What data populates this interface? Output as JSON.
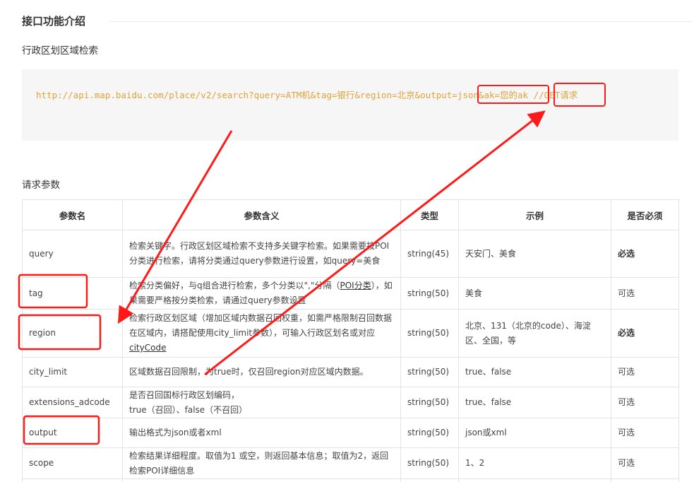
{
  "section": {
    "title": "接口功能介绍",
    "subtitle": "行政区划区域检索"
  },
  "code": {
    "url": "http://api.map.baidu.com/place/v2/search?query=ATM机&tag=银行&region=北京&output=json&ak=您的ak //GET请求"
  },
  "params": {
    "label": "请求参数",
    "headers": [
      "参数名",
      "参数含义",
      "类型",
      "示例",
      "是否必须"
    ],
    "rows": [
      {
        "name": "query",
        "desc": "检索关键字。行政区划区域检索不支持多关键字检索。如果需要按POI分类进行检索，请将分类通过query参数进行设置，如query=美食",
        "type": "string(45)",
        "example": "天安门、美食",
        "required": "必选"
      },
      {
        "name": "tag",
        "desc_before": "检索分类偏好，与q组合进行检索，多个分类以\",\"分隔（",
        "desc_link": "POI分类",
        "desc_after": "），如果需要严格按分类检索，请通过query参数设置",
        "type": "string(50)",
        "example": "美食",
        "required": "可选"
      },
      {
        "name": "region",
        "desc_before": "检索行政区划区域（增加区域内数据召回权重，如需严格限制召回数据在区域内，请搭配使用city_limit参数），可输入行政区划名或对应",
        "desc_link": "cityCode",
        "desc_after": "",
        "type": "string(50)",
        "example": "北京、131（北京的code）、海淀区、全国，等",
        "required": "必选"
      },
      {
        "name": "city_limit",
        "desc": "区域数据召回限制，为true时，仅召回region对应区域内数据。",
        "type": "string(50)",
        "example": "true、false",
        "required": "可选"
      },
      {
        "name": "extensions_adcode",
        "desc_line1": "是否召回国标行政区划编码，",
        "desc_line2": "true（召回）、false（不召回）",
        "type": "string(50)",
        "example": "true、false",
        "required": "可选"
      },
      {
        "name": "output",
        "desc": "输出格式为json或者xml",
        "type": "string(50)",
        "example": "json或xml",
        "required": "可选"
      },
      {
        "name": "scope",
        "desc": "检索结果详细程度。取值为1 或空，则返回基本信息；取值为2，返回检索POI详细信息",
        "type": "string(50)",
        "example": "1、2",
        "required": "可选"
      }
    ]
  },
  "colors": {
    "code_text": "#e0a23c",
    "annotation": "#ff1a1a",
    "code_bg": "#f6f6f6",
    "border": "#e3e3e3"
  }
}
